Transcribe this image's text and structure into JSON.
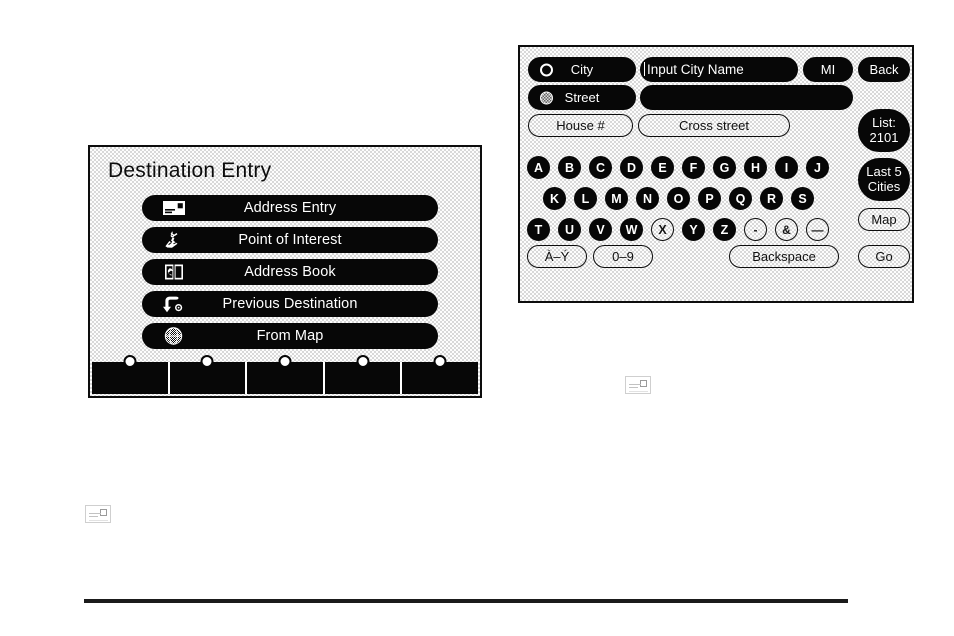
{
  "destination_screen": {
    "title": "Destination Entry",
    "menu_items": [
      {
        "label": "Address Entry",
        "icon": "envelope-card-icon"
      },
      {
        "label": "Point of Interest",
        "icon": "statue-of-liberty-icon"
      },
      {
        "label": "Address Book",
        "icon": "open-book-icon"
      },
      {
        "label": "Previous Destination",
        "icon": "return-arrow-icon"
      },
      {
        "label": "From Map",
        "icon": "globe-icon"
      }
    ],
    "hardkey_count": 5
  },
  "keyboard_screen": {
    "city_button": {
      "label": "City",
      "selected": false,
      "radio": "radio-unselected-icon"
    },
    "street_button": {
      "label": "Street",
      "selected": true,
      "radio": "radio-selected-icon"
    },
    "city_field": {
      "value": "Input City Name",
      "placeholder": "Input City Name"
    },
    "street_field": {
      "value": "",
      "placeholder": ""
    },
    "state_button": {
      "label": "MI"
    },
    "back_button": {
      "label": "Back"
    },
    "house_button": {
      "label": "House #"
    },
    "cross_street_button": {
      "label": "Cross street"
    },
    "list_button": {
      "line1": "List:",
      "line2": "2101"
    },
    "last5_button": {
      "line1": "Last 5",
      "line2": "Cities"
    },
    "map_button": {
      "label": "Map"
    },
    "go_button": {
      "label": "Go"
    },
    "keyboard_rows": [
      [
        {
          "label": "A",
          "enabled": true
        },
        {
          "label": "B",
          "enabled": true
        },
        {
          "label": "C",
          "enabled": true
        },
        {
          "label": "D",
          "enabled": true
        },
        {
          "label": "E",
          "enabled": true
        },
        {
          "label": "F",
          "enabled": true
        },
        {
          "label": "G",
          "enabled": true
        },
        {
          "label": "H",
          "enabled": true
        },
        {
          "label": "I",
          "enabled": true
        },
        {
          "label": "J",
          "enabled": true
        }
      ],
      [
        {
          "label": "K",
          "enabled": true
        },
        {
          "label": "L",
          "enabled": true
        },
        {
          "label": "M",
          "enabled": true
        },
        {
          "label": "N",
          "enabled": true
        },
        {
          "label": "O",
          "enabled": true
        },
        {
          "label": "P",
          "enabled": true
        },
        {
          "label": "Q",
          "enabled": true
        },
        {
          "label": "R",
          "enabled": true
        },
        {
          "label": "S",
          "enabled": true
        }
      ],
      [
        {
          "label": "T",
          "enabled": true
        },
        {
          "label": "U",
          "enabled": true
        },
        {
          "label": "V",
          "enabled": true
        },
        {
          "label": "W",
          "enabled": true
        },
        {
          "label": "X",
          "enabled": false
        },
        {
          "label": "Y",
          "enabled": true
        },
        {
          "label": "Z",
          "enabled": true
        },
        {
          "label": "-",
          "enabled": false
        },
        {
          "label": "&",
          "enabled": false
        },
        {
          "label": "—",
          "enabled": false
        }
      ]
    ],
    "accent_button": {
      "label": "À–Ý"
    },
    "numeric_button": {
      "label": "0–9"
    },
    "backspace_button": {
      "label": "Backspace"
    }
  },
  "markers": [
    {
      "name": "envelope-marker-left"
    },
    {
      "name": "envelope-marker-center"
    }
  ],
  "colors": {
    "ink": "#070707",
    "screen_gray": "#d8d8d8",
    "page_white": "#ffffff",
    "marker_gray": "#cfcfcf"
  }
}
